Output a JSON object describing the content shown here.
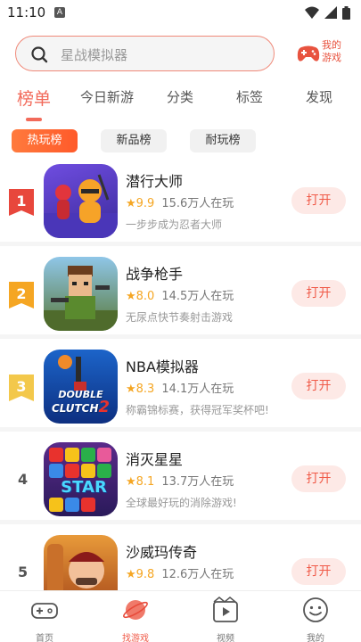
{
  "status_bar": {
    "time": "11:10",
    "notif_letter": "A"
  },
  "search": {
    "placeholder": "星战模拟器"
  },
  "my_games": {
    "label": "我的游戏",
    "icon": "gamepad-icon"
  },
  "tabs": [
    {
      "label": "榜单",
      "active": true
    },
    {
      "label": "今日新游",
      "active": false
    },
    {
      "label": "分类",
      "active": false
    },
    {
      "label": "标签",
      "active": false
    },
    {
      "label": "发现",
      "active": false
    }
  ],
  "subtabs": [
    {
      "label": "热玩榜",
      "active": true
    },
    {
      "label": "新品榜",
      "active": false
    },
    {
      "label": "耐玩榜",
      "active": false
    }
  ],
  "games": [
    {
      "rank": "1",
      "name": "潜行大师",
      "star": "★",
      "score": "9.9",
      "players": "15.6万人在玩",
      "desc": "一步步成为忍者大师",
      "button": "打开"
    },
    {
      "rank": "2",
      "name": "战争枪手",
      "star": "★",
      "score": "8.0",
      "players": "14.5万人在玩",
      "desc": "无尿点快节奏射击游戏",
      "button": "打开"
    },
    {
      "rank": "3",
      "name": "NBA模拟器",
      "star": "★",
      "score": "8.3",
      "players": "14.1万人在玩",
      "desc": "称霸锦标赛，获得冠军奖杯吧!",
      "button": "打开"
    },
    {
      "rank": "4",
      "name": "消灭星星",
      "star": "★",
      "score": "8.1",
      "players": "13.7万人在玩",
      "desc": "全球最好玩的消除游戏!",
      "button": "打开"
    },
    {
      "rank": "5",
      "name": "沙威玛传奇",
      "star": "★",
      "score": "9.8",
      "players": "12.6万人在玩",
      "desc": "",
      "button": "打开"
    }
  ],
  "icon_texts": {
    "double_clutch_1": "DOUBLE",
    "double_clutch_2": "CLUTCH",
    "double_clutch_num": "2",
    "star_logo": "STAR"
  },
  "bottom_nav": [
    {
      "label": "首页",
      "icon": "gamepad-home-icon",
      "active": false
    },
    {
      "label": "找游戏",
      "icon": "planet-icon",
      "active": true
    },
    {
      "label": "视频",
      "icon": "video-icon",
      "active": false
    },
    {
      "label": "我的",
      "icon": "smiley-icon",
      "active": false
    }
  ],
  "colors": {
    "accent": "#f26a5a",
    "star": "#f5a623",
    "rank1": "#e8473c",
    "rank2": "#f5a623",
    "rank3": "#f3c84b"
  }
}
